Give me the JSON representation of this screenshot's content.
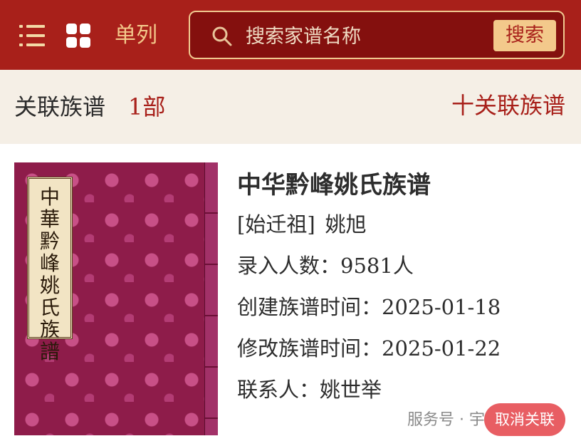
{
  "header": {
    "view_label": "单列",
    "search_placeholder": "搜索家谱名称",
    "search_button": "搜索",
    "colors": {
      "bar": "#a8201a",
      "accent": "#f3c98b"
    }
  },
  "section": {
    "title": "关联族谱",
    "count": "1部",
    "link_label": "十关联族谱"
  },
  "book": {
    "cover_text": "中華黔峰姚氏族譜",
    "title": "中华黔峰姚氏族谱",
    "ancestor_label": "[始迁祖]",
    "ancestor": "姚旭",
    "count_label": "录入人数：",
    "count": "9581人",
    "created_label": "创建族谱时间：",
    "created": "2025-01-18",
    "modified_label": "修改族谱时间：",
    "modified": "2025-01-22",
    "contact_label": "联系人：",
    "contact": "姚世举"
  },
  "footer": {
    "watermark": "服务号 · 宇和云谱",
    "unlink_button": "取消关联"
  }
}
